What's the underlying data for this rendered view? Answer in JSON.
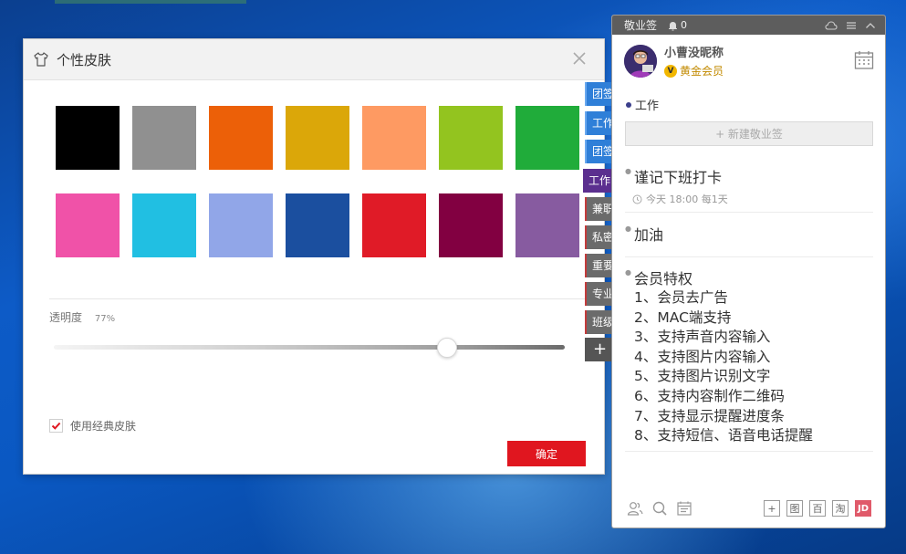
{
  "dialog": {
    "title": "个性皮肤",
    "close_icon": "close-icon",
    "swatch_colors": [
      "#000000",
      "#909090",
      "#ec6008",
      "#dba709",
      "#fe9a62",
      "#93c41f",
      "#20ac3a",
      "#f052a8",
      "#21bfe2",
      "#91a6e8",
      "#1b4f9f",
      "#e01b27",
      "#820041",
      "#875ba0"
    ],
    "opacity_label": "透明度",
    "opacity_value": "77%",
    "opacity_level": 0.77,
    "classic_skin_label": "使用经典皮肤",
    "classic_skin_checked": true,
    "ok_label": "确定"
  },
  "tabs": [
    {
      "label": "团签",
      "style": "blue"
    },
    {
      "label": "工作",
      "style": "blue"
    },
    {
      "label": "团签",
      "style": "blue"
    },
    {
      "label": "工作",
      "style": "purple"
    },
    {
      "label": "兼职",
      "style": "gray"
    },
    {
      "label": "私密",
      "style": "gray"
    },
    {
      "label": "重要",
      "style": "gray"
    },
    {
      "label": "专业",
      "style": "gray"
    },
    {
      "label": "班级",
      "style": "gray"
    },
    {
      "label": "+",
      "style": "add"
    }
  ],
  "panel": {
    "app_name": "敬业签",
    "notification_count": "0",
    "user_name": "小曹没昵称",
    "member_level": "黄金会员",
    "vip_badge": "V",
    "category": "工作",
    "new_note_label": "+ 新建敬业签",
    "notes": [
      {
        "title": "谨记下班打卡",
        "time": "今天 18:00 每1天"
      },
      {
        "title": "加油"
      },
      {
        "title": "会员特权",
        "lines": [
          "1、会员去广告",
          "2、MAC端支持",
          "3、支持声音内容输入",
          "4、支持图片内容输入",
          "5、支持图片识别文字",
          "6、支持内容制作二维码",
          "7、支持显示提醒进度条",
          "8、支持短信、语音电话提醒"
        ]
      }
    ],
    "bottom_right": [
      "+",
      "图",
      "百",
      "淘",
      "JD"
    ]
  }
}
